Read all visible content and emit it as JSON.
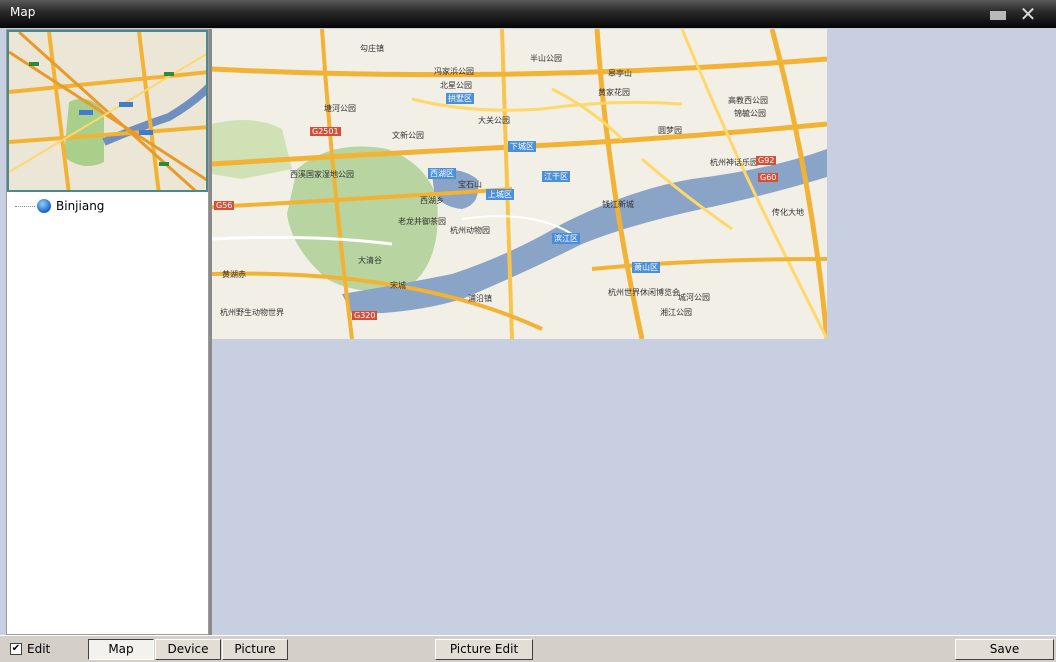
{
  "window": {
    "title": "Map"
  },
  "tree": {
    "items": [
      {
        "label": "Binjiang"
      }
    ]
  },
  "map": {
    "labels": [
      {
        "text": "勾庄镇"
      },
      {
        "text": "半山公园"
      },
      {
        "text": "冯家浜公园"
      },
      {
        "text": "皋亭山"
      },
      {
        "text": "北星公园"
      },
      {
        "text": "黄家花园"
      },
      {
        "text": "拱墅区"
      },
      {
        "text": "塘河公园"
      },
      {
        "text": "高教西公园"
      },
      {
        "text": "大关公园"
      },
      {
        "text": "锦毓公园"
      },
      {
        "text": "文新公园"
      },
      {
        "text": "下城区"
      },
      {
        "text": "圆梦园"
      },
      {
        "text": "G2501"
      },
      {
        "text": "西溪国家湿地公园"
      },
      {
        "text": "西湖区"
      },
      {
        "text": "宝石山"
      },
      {
        "text": "江干区"
      },
      {
        "text": "杭州神话乐园"
      },
      {
        "text": "G92"
      },
      {
        "text": "G60"
      },
      {
        "text": "G56"
      },
      {
        "text": "上城区"
      },
      {
        "text": "西湖乡"
      },
      {
        "text": "钱江新城"
      },
      {
        "text": "杭州动物园"
      },
      {
        "text": "老龙井御茶园"
      },
      {
        "text": "滨江区"
      },
      {
        "text": "传化大地"
      },
      {
        "text": "大清谷"
      },
      {
        "text": "萧山区"
      },
      {
        "text": "黄湖赤"
      },
      {
        "text": "宋城"
      },
      {
        "text": "浦沿镇"
      },
      {
        "text": "杭州世界休闲博览会"
      },
      {
        "text": "城河公园"
      },
      {
        "text": "杭州野生动物世界"
      },
      {
        "text": "湘江公园"
      },
      {
        "text": "G320"
      }
    ]
  },
  "bottom": {
    "edit_label": "Edit",
    "edit_checked": "✔",
    "tabs": [
      {
        "label": "Map"
      },
      {
        "label": "Device"
      },
      {
        "label": "Picture"
      }
    ],
    "picture_edit_label": "Picture Edit",
    "save_label": "Save"
  },
  "colors": {
    "map_water": "#8aa4c8",
    "map_green": "#b7d39f",
    "highway": "#f2b233",
    "panel_bg": "#c8cfe0"
  }
}
